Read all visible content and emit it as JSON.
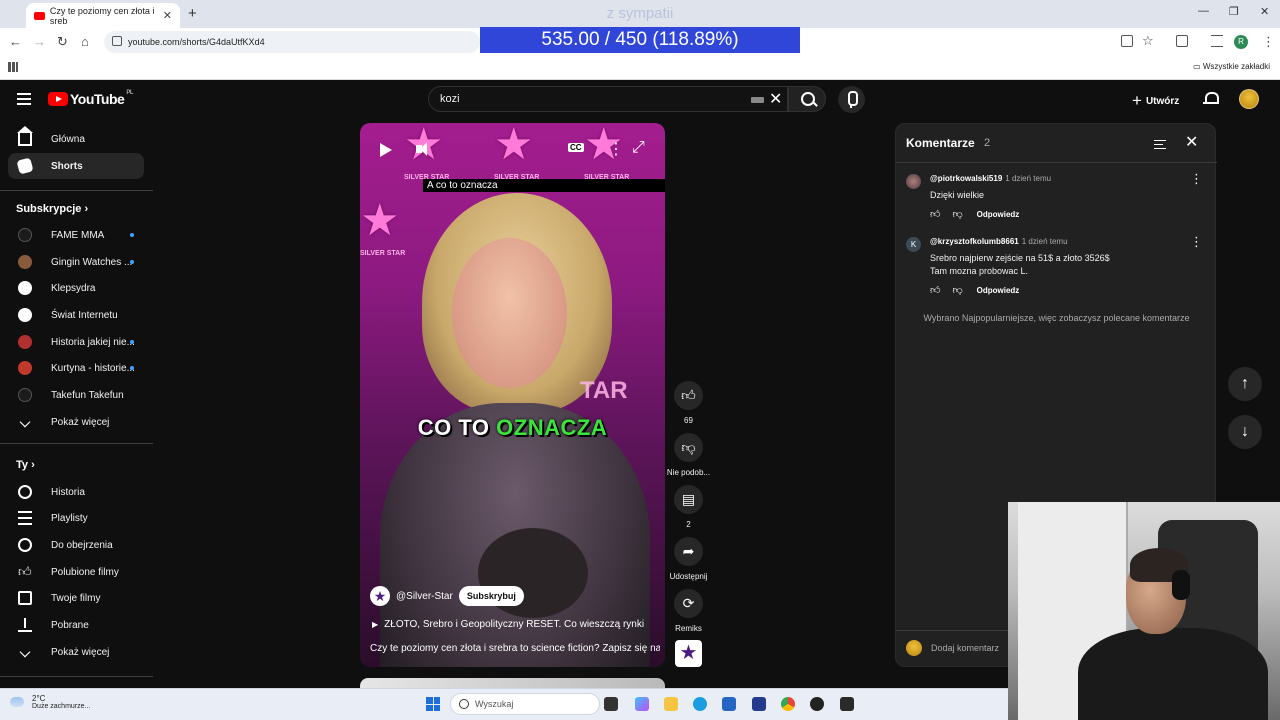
{
  "browser": {
    "tab_title": "Czy te poziomy cen złota i sreb",
    "url": "youtube.com/shorts/G4daUtfKXd4",
    "bookmarks_all": "Wszystkie zakładki",
    "profile_initial": "R"
  },
  "stream_overlay": {
    "top_text": "z sympatii",
    "banner": "535.00 / 450 (118.89%)"
  },
  "yt_header": {
    "logo": "YouTube",
    "country": "PL",
    "search_value": "kozi",
    "create_label": "Utwórz"
  },
  "sidebar": {
    "main": [
      {
        "label": "Główna",
        "icon": "home-icon"
      },
      {
        "label": "Shorts",
        "icon": "shorts-icon"
      }
    ],
    "subs_title": "Subskrypcje",
    "subs": [
      {
        "label": "FAME MMA",
        "color": "#1b1b1b",
        "dot": true
      },
      {
        "label": "Gingin Watches ...",
        "color": "#8a5a3c",
        "dot": true
      },
      {
        "label": "Klepsydra",
        "color": "#ffffff",
        "dot": false
      },
      {
        "label": "Świat Internetu",
        "color": "#ffffff",
        "dot": false
      },
      {
        "label": "Historia jakiej nie...",
        "color": "#b03030",
        "dot": true
      },
      {
        "label": "Kurtyna - historie...",
        "color": "#c0392b",
        "dot": true
      },
      {
        "label": "Takefun Takefun",
        "color": "#1b1b1b",
        "dot": false
      }
    ],
    "subs_more": "Pokaż więcej",
    "you_title": "Ty",
    "you": [
      {
        "label": "Historia",
        "icon": "history-icon"
      },
      {
        "label": "Playlisty",
        "icon": "playlist-icon"
      },
      {
        "label": "Do obejrzenia",
        "icon": "watch-later-icon"
      },
      {
        "label": "Polubione filmy",
        "icon": "like-icon"
      },
      {
        "label": "Twoje filmy",
        "icon": "your-videos-icon"
      },
      {
        "label": "Pobrane",
        "icon": "download-icon"
      }
    ],
    "you_more": "Pokaż więcej"
  },
  "video": {
    "star_label": "SILVER STAR",
    "caption_top": "A co to oznacza",
    "big_caption_a": "CO TO ",
    "big_caption_b": "OZNACZA",
    "bg_text": "TAR",
    "channel": "@Silver-Star",
    "subscribe": "Subskrybuj",
    "title": "ZŁOTO, Srebro i Geopolityczny RESET. Co wieszczą rynki",
    "description": "Czy te poziomy cen złota i srebra to science fiction? Zapisz się na ..."
  },
  "actions": {
    "likes": "69",
    "dislike": "Nie podob...",
    "comments": "2",
    "share": "Udostępnij",
    "remix": "Remiks"
  },
  "comments_panel": {
    "title": "Komentarze",
    "count": "2",
    "items": [
      {
        "user": "@piotrkowalski519",
        "time": "1 dzień temu",
        "text": "Dzięki wielkie",
        "reply": "Odpowiedz"
      },
      {
        "user": "@krzysztofkolumb8661",
        "time": "1 dzień temu",
        "text": "Srebro najpierw zejście na 51$ a złoto 3526$",
        "text2": "Tam mozna probowac L.",
        "initial": "K",
        "reply": "Odpowiedz"
      }
    ],
    "note": "Wybrano Najpopularniejsze, więc zobaczysz polecane komentarze",
    "add_placeholder": "Dodaj komentarz"
  },
  "taskbar": {
    "temp": "2°C",
    "weather": "Duże zachmurze...",
    "search": "Wyszukaj"
  }
}
